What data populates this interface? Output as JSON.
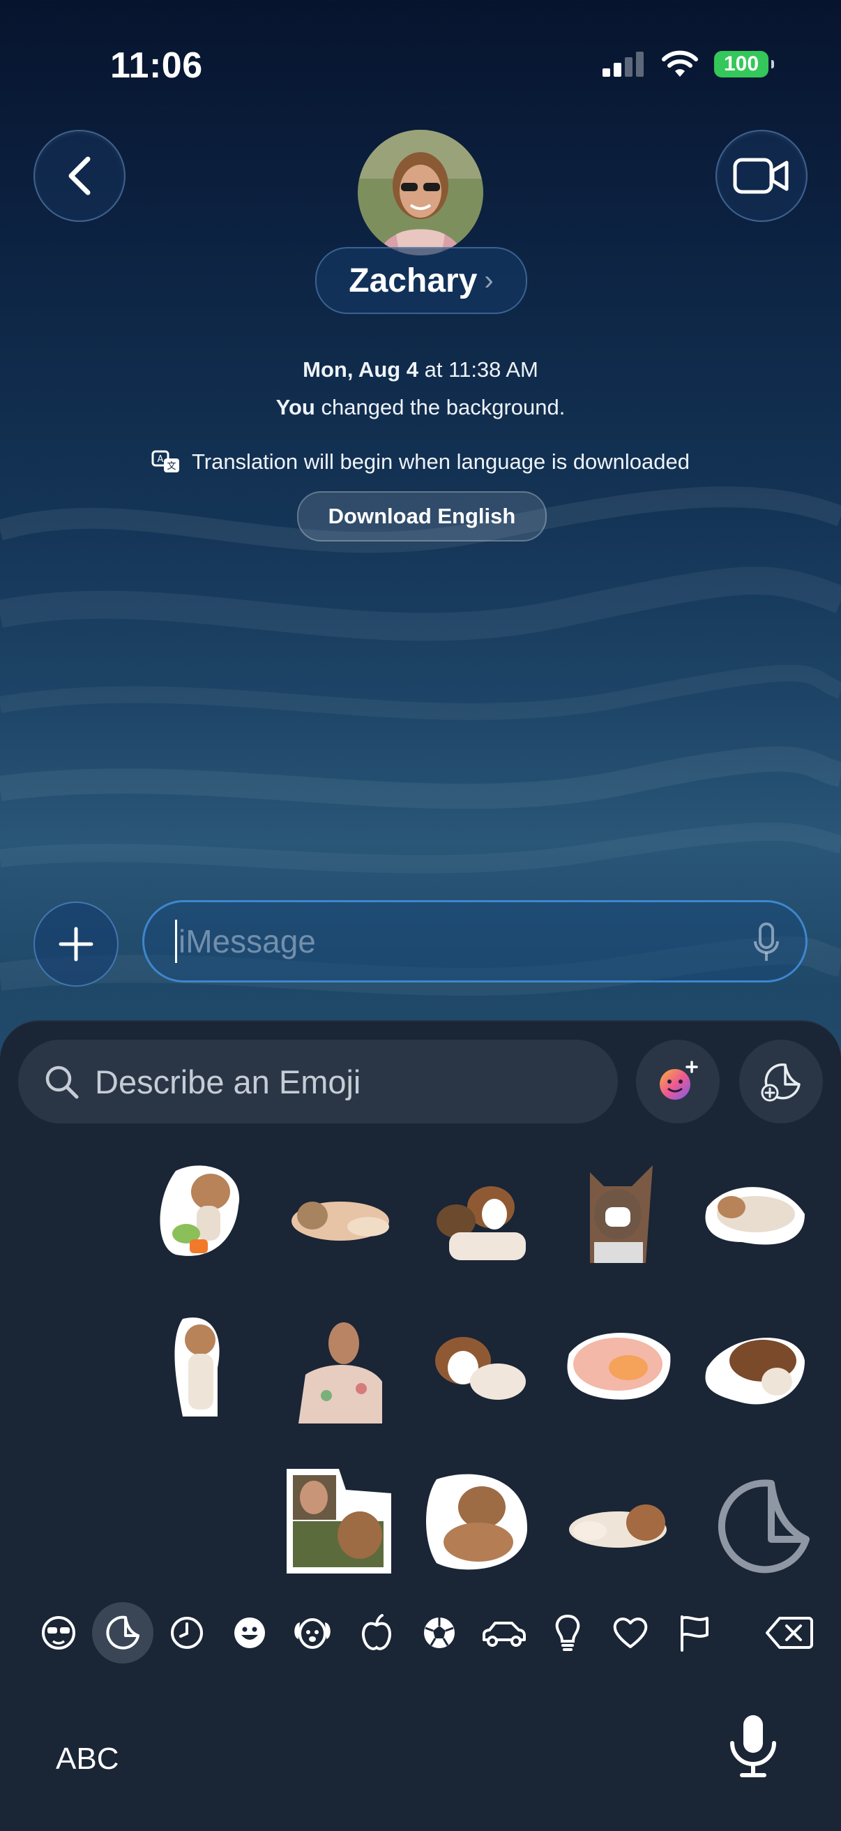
{
  "status": {
    "time": "11:06",
    "battery": "100"
  },
  "header": {
    "name": "Zachary",
    "chevron": "›"
  },
  "meta": {
    "date_day": "Mon, Aug 4",
    "date_at": "at 11:38 AM",
    "change_you": "You",
    "change_rest": "changed the background.",
    "translation": "Translation will begin when language is downloaded",
    "download_label": "Download English"
  },
  "compose": {
    "placeholder": "iMessage"
  },
  "emoji_panel": {
    "search_placeholder": "Describe an Emoji"
  },
  "keyboard": {
    "abc_label": "ABC"
  },
  "colors": {
    "accent": "#3e9bf0",
    "battery": "#34c759",
    "panel": "#1a2536"
  },
  "categories": [
    "memoji-icon",
    "sticker-icon",
    "recent-clock-icon",
    "smiley-icon",
    "animal-icon",
    "food-apple-icon",
    "soccer-ball-icon",
    "car-icon",
    "lightbulb-icon",
    "heart-icon",
    "flag-icon",
    "delete-backspace-icon"
  ]
}
